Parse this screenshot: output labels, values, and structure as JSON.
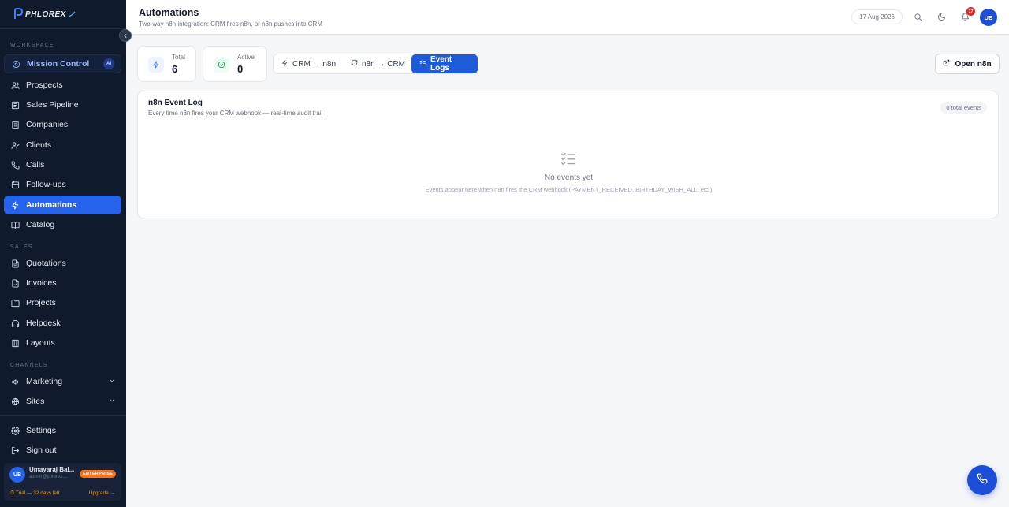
{
  "brand": {
    "logo_text": "PHLOREX"
  },
  "sidebar": {
    "sections": {
      "workspace": "WORKSPACE",
      "sales": "SALES",
      "channels": "CHANNELS"
    },
    "mission_control": {
      "label": "Mission Control",
      "badge": "AI"
    },
    "workspace_items": [
      {
        "label": "Prospects",
        "icon": "users-icon"
      },
      {
        "label": "Sales Pipeline",
        "icon": "pipeline-icon"
      },
      {
        "label": "Companies",
        "icon": "building-icon"
      },
      {
        "label": "Clients",
        "icon": "user-check-icon"
      },
      {
        "label": "Calls",
        "icon": "phone-icon"
      },
      {
        "label": "Follow-ups",
        "icon": "calendar-icon"
      },
      {
        "label": "Automations",
        "icon": "bolt-icon",
        "active": true
      },
      {
        "label": "Catalog",
        "icon": "book-icon"
      }
    ],
    "sales_items": [
      {
        "label": "Quotations",
        "icon": "document-icon"
      },
      {
        "label": "Invoices",
        "icon": "file-icon"
      },
      {
        "label": "Projects",
        "icon": "folder-icon"
      },
      {
        "label": "Helpdesk",
        "icon": "headset-icon"
      },
      {
        "label": "Layouts",
        "icon": "layout-icon"
      }
    ],
    "channel_items": [
      {
        "label": "Marketing",
        "icon": "megaphone-icon"
      },
      {
        "label": "Sites",
        "icon": "globe-icon"
      }
    ],
    "footer_items": [
      {
        "label": "Settings",
        "icon": "gear-icon"
      },
      {
        "label": "Sign out",
        "icon": "logout-icon"
      }
    ],
    "user": {
      "initials": "UB",
      "name": "Umayaraj Bal...",
      "email": "admin@phlorex....",
      "plan": "ENTERPRISE",
      "trial": "⏱ Trial — 32 days left",
      "upgrade": "Upgrade →"
    }
  },
  "header": {
    "title": "Automations",
    "subtitle": "Two-way n8n integration: CRM fires n8n, or n8n pushes into CRM",
    "date": "17 Aug 2026",
    "notification_count": "17",
    "avatar_initials": "UB"
  },
  "stats": [
    {
      "label": "Total",
      "value": "6",
      "icon": "bolt-icon",
      "color": "#3b82f6",
      "bg": "#eef4ff"
    },
    {
      "label": "Active",
      "value": "0",
      "icon": "check-circle-icon",
      "color": "#16a34a",
      "bg": "#ecfdf3"
    }
  ],
  "tabs": [
    {
      "label": "CRM → n8n",
      "icon": "bolt-icon"
    },
    {
      "label": "n8n → CRM",
      "icon": "refresh-icon"
    },
    {
      "label": "Event Logs",
      "icon": "list-check-icon",
      "active": true
    }
  ],
  "open_button": {
    "label": "Open n8n"
  },
  "event_log": {
    "title": "n8n Event Log",
    "subtitle": "Every time n8n fires your CRM webhook — real-time audit trail",
    "total": "0 total events",
    "empty_title": "No events yet",
    "empty_subtitle": "Events appear here when n8n fires the CRM webhook (PAYMENT_RECEIVED, BIRTHDAY_WISH_ALL, etc.)"
  },
  "colors": {
    "sidebar_bg": "#0f1b2d",
    "accent": "#2563eb",
    "badge_orange": "#f97316"
  }
}
